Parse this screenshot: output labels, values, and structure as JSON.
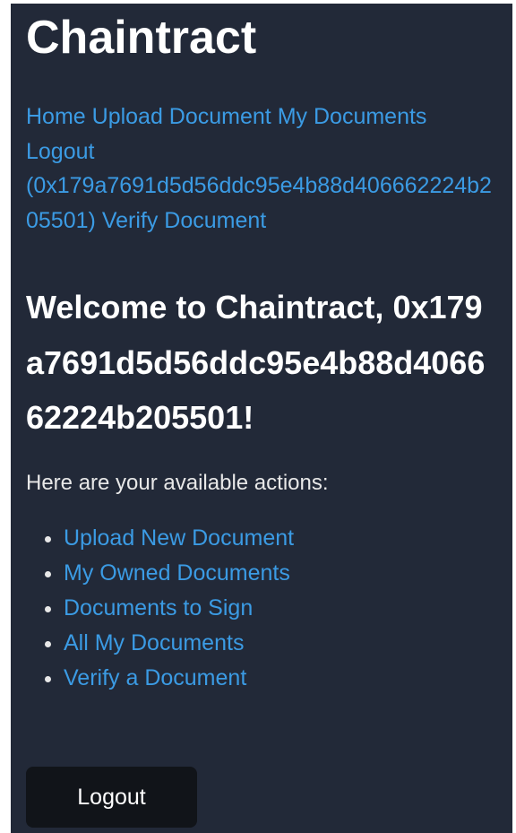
{
  "app": {
    "title": "Chaintract"
  },
  "nav": {
    "home": "Home",
    "upload": "Upload Document",
    "my_documents": "My Documents",
    "logout": "Logout",
    "address": "(0x179a7691d5d56ddc95e4b88d406662224b205501)",
    "verify": "Verify Document"
  },
  "welcome": {
    "prefix": "Welcome to Chaintract,",
    "address": "0x179a7691d5d56ddc95e4b88d406662224b205501",
    "suffix": "!"
  },
  "intro": "Here are your available actions:",
  "actions": [
    "Upload New Document",
    "My Owned Documents",
    "Documents to Sign",
    "All My Documents",
    "Verify a Document"
  ],
  "logout_button": "Logout",
  "colors": {
    "background": "#222938",
    "link": "#3b9be4",
    "button": "#111419"
  }
}
